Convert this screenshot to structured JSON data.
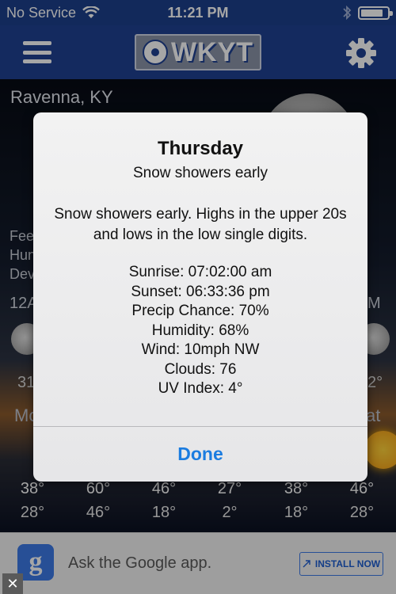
{
  "status_bar": {
    "carrier": "No Service",
    "time": "11:21 PM",
    "battery_level": 0.85
  },
  "navbar": {
    "logo_text": "WKYT"
  },
  "background": {
    "location": "Ravenna, KY",
    "labels": [
      "Fee",
      "Hun",
      "Dev"
    ],
    "hour_left": "12A",
    "hour_right": "M",
    "temp_left": "31",
    "temp_right": "2°",
    "day_left": "Mo",
    "day_right": "at"
  },
  "temperature_row": [
    {
      "hi": "38°",
      "lo": "28°"
    },
    {
      "hi": "60°",
      "lo": "46°"
    },
    {
      "hi": "46°",
      "lo": "18°"
    },
    {
      "hi": "27°",
      "lo": "2°"
    },
    {
      "hi": "38°",
      "lo": "18°"
    },
    {
      "hi": "46°",
      "lo": "28°"
    }
  ],
  "modal": {
    "title": "Thursday",
    "subtitle": "Snow showers early",
    "description": "Snow showers early. Highs in the upper 20s and lows in the low single digits.",
    "details": [
      "Sunrise: 07:02:00 am",
      "Sunset: 06:33:36 pm",
      "Precip Chance: 70%",
      "Humidity: 68%",
      "Wind: 10mph NW",
      "Clouds: 76",
      "UV Index: 4°"
    ],
    "done_label": "Done"
  },
  "ad": {
    "icon_letter": "g",
    "text": "Ask the Google app.",
    "install_label": "INSTALL NOW",
    "close_label": "✕"
  },
  "colors": {
    "nav_blue": "#1f4193",
    "done_blue": "#1b7ce0"
  }
}
